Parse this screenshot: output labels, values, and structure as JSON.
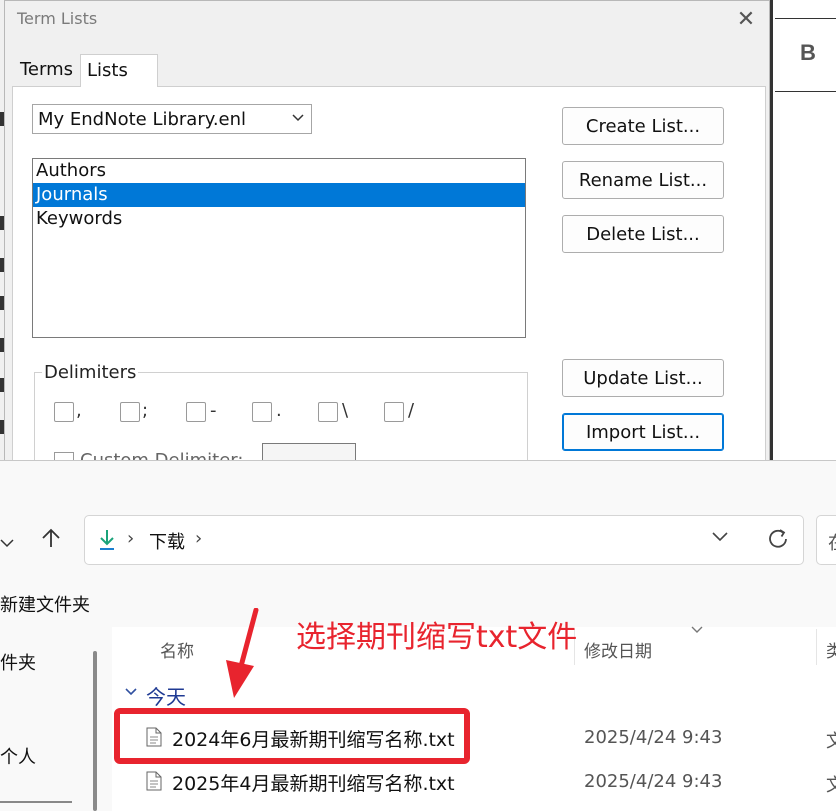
{
  "dialog": {
    "title": "Term Lists",
    "close_glyph": "✕",
    "tabs": [
      {
        "label": "Terms"
      },
      {
        "label": "Lists"
      }
    ],
    "library_select": {
      "value": "My EndNote Library.enl"
    },
    "lists": [
      {
        "label": "Authors",
        "selected": false
      },
      {
        "label": "Journals",
        "selected": true
      },
      {
        "label": "Keywords",
        "selected": false
      }
    ],
    "buttons": {
      "create": "Create List...",
      "rename": "Rename List...",
      "delete": "Delete List...",
      "update": "Update List...",
      "import": "Import List..."
    },
    "delimiters": {
      "legend": "Delimiters",
      "options": [
        ",",
        ";",
        "-",
        ".",
        "\\",
        "/"
      ],
      "custom_label": "Custom Delimiter:"
    }
  },
  "background_app": {
    "letter": "B"
  },
  "explorer": {
    "breadcrumb": {
      "sep": "›",
      "folder": "下载"
    },
    "search_placeholder_char": "在",
    "command_new_folder": "新建文件夹",
    "nav_items": [
      "件夹",
      "个人"
    ],
    "columns": {
      "name": "名称",
      "modified": "修改日期",
      "type_partial": "类"
    },
    "group_label": "今天",
    "files": [
      {
        "name": "2024年6月最新期刊缩写名称.txt",
        "modified": "2025/4/24 9:43",
        "type_partial": "文"
      },
      {
        "name": "2025年4月最新期刊缩写名称.txt",
        "modified": "2025/4/24 9:43",
        "type_partial": "文"
      }
    ]
  },
  "annotation": {
    "text": "选择期刊缩写txt文件",
    "color": "#e8242e"
  }
}
